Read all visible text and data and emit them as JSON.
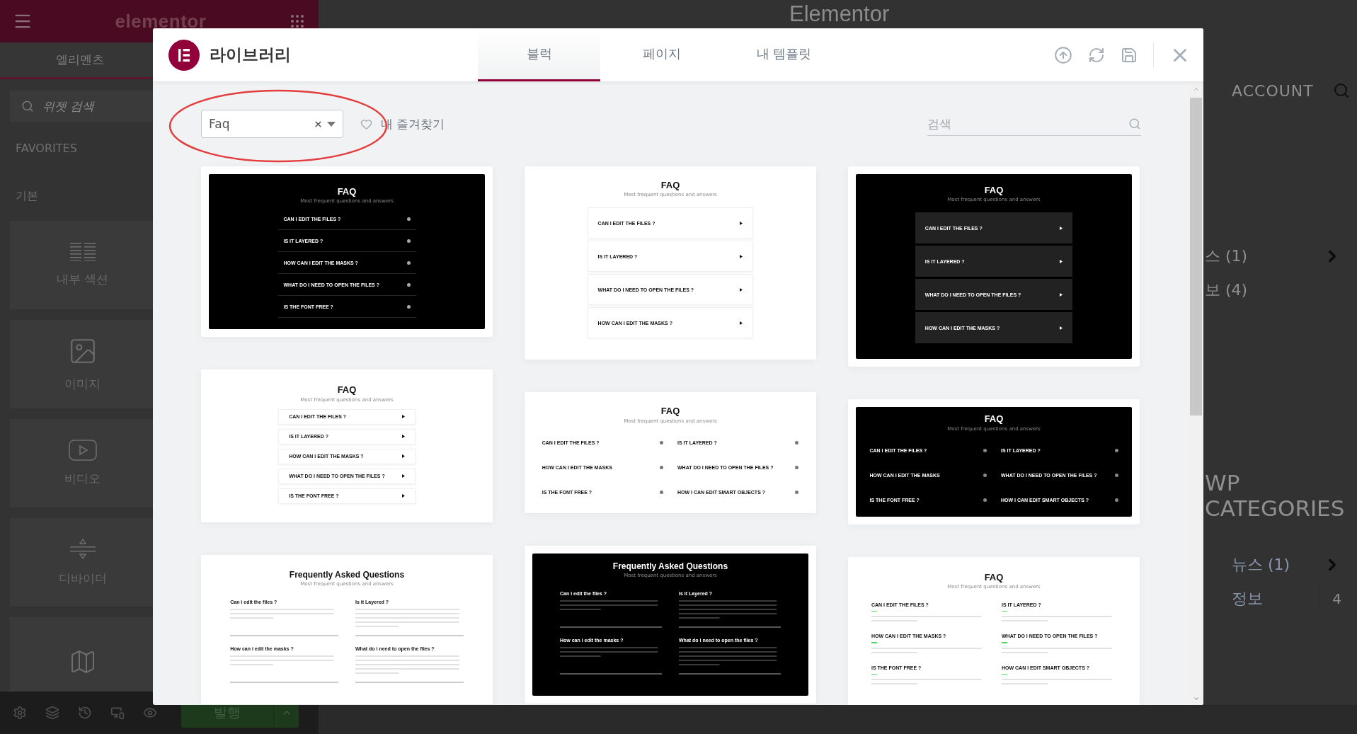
{
  "editor_panel": {
    "logo": "elementor",
    "tabs": [
      {
        "label": "엘리멘츠",
        "selected": true
      }
    ],
    "search": {
      "placeholder": "위젯 검색"
    },
    "headings": [
      "FAVORITES",
      "기본"
    ],
    "widgets": [
      {
        "kind": "inner-section",
        "label": "내부 섹션"
      },
      {
        "kind": "image",
        "label": "이미지"
      },
      {
        "kind": "video",
        "label": "비디오"
      },
      {
        "kind": "divider",
        "label": "디바이더"
      },
      {
        "kind": "map"
      }
    ],
    "publish_button": "발행"
  },
  "page_background": {
    "title": "Elementor",
    "account": "ACCOUNT",
    "list_1": [
      {
        "label": "스 (1)",
        "has_submenu": true
      },
      {
        "label": "보 (4)",
        "has_submenu": false
      }
    ],
    "heading_lines": [
      "WP",
      "CATEGORIES"
    ],
    "list_2": [
      {
        "label": "뉴스 (1)",
        "has_submenu": true
      },
      {
        "label": "정보",
        "count": "4",
        "has_submenu": false
      }
    ]
  },
  "library_modal": {
    "title": "라이브러리",
    "tabs": [
      {
        "label": "블럭",
        "selected": true
      },
      {
        "label": "페이지",
        "selected": false
      },
      {
        "label": "내 템플릿",
        "selected": false
      }
    ],
    "filter": {
      "category": "Faq",
      "favorites_label": "내 즐겨찾기"
    },
    "search": {
      "placeholder": "검색"
    },
    "template_columns": [
      {
        "templates": [
          {
            "kind": "list",
            "dark": true,
            "title": "FAQ",
            "subtitle": "Most frequent questions and answers",
            "questions": [
              "CAN I EDIT THE FILES ?",
              "IS IT LAYERED ?",
              "HOW CAN I EDIT THE MASKS ?",
              "WHAT DO I NEED TO OPEN THE FILES ?",
              "IS THE FONT FREE ?"
            ]
          },
          {
            "kind": "boxed",
            "dark": false,
            "title": "FAQ",
            "subtitle": "Most frequent questions and answers",
            "questions": [
              "CAN I EDIT THE FILES ?",
              "IS IT LAYERED ?",
              "HOW CAN I EDIT THE MASKS ?",
              "WHAT DO I NEED TO OPEN THE FILES ?",
              "IS THE FONT FREE ?"
            ]
          },
          {
            "kind": "qa",
            "dark": false,
            "title": "Frequently Asked Questions",
            "subtitle": "Most frequent questions and answers",
            "questions": [
              "Can i edit the files ?",
              "Is it Layered ?",
              "How can i edit the masks ?",
              "What do i need to open the files ?"
            ]
          }
        ]
      },
      {
        "templates": [
          {
            "kind": "boxed",
            "dark": false,
            "title": "FAQ",
            "subtitle": "Most frequent questions and answers",
            "questions": [
              "CAN I EDIT THE FILES ?",
              "IS IT LAYERED ?",
              "WHAT DO I NEED TO OPEN THE FILES ?",
              "HOW CAN I EDIT THE MASKS ?"
            ]
          },
          {
            "kind": "grid",
            "dark": false,
            "title": "FAQ",
            "subtitle": "Most frequent questions and answers",
            "questions": [
              "CAN I EDIT THE FILES ?",
              "IS IT LAYERED ?",
              "HOW CAN I EDIT THE MASKS",
              "WHAT DO I NEED TO OPEN THE FILES ?",
              "IS THE FONT FREE ?",
              "HOW I CAN EDIT SMART OBJECTS ?"
            ]
          },
          {
            "kind": "qa",
            "dark": true,
            "title": "Frequently Asked Questions",
            "subtitle": "Most frequent questions and answers",
            "questions": [
              "Can i edit the files ?",
              "Is it Layered ?",
              "How can i edit the masks ?",
              "What do i need to open the files ?"
            ]
          }
        ]
      },
      {
        "templates": [
          {
            "kind": "boxed",
            "dark": true,
            "title": "FAQ",
            "subtitle": "Most frequent questions and answers",
            "questions": [
              "CAN I EDIT THE FILES ?",
              "IS IT LAYERED ?",
              "WHAT DO I NEED TO OPEN THE FILES ?",
              "HOW CAN I EDIT THE MASKS ?"
            ]
          },
          {
            "kind": "grid",
            "dark": true,
            "title": "FAQ",
            "subtitle": "Most frequent questions and answers",
            "questions": [
              "CAN I EDIT THE FILES ?",
              "IS IT LAYERED ?",
              "HOW CAN I EDIT THE MASKS",
              "WHAT DO I NEED TO OPEN THE FILES ?",
              "IS THE FONT FREE ?",
              "HOW I CAN EDIT SMART OBJECTS ?"
            ]
          },
          {
            "kind": "dashed",
            "dark": false,
            "title": "FAQ",
            "subtitle": "Most frequent questions and answers",
            "questions": [
              "CAN I EDIT THE FILES ?",
              "IS IT LAYERED ?",
              "HOW CAN I EDIT THE MASKS ?",
              "WHAT DO I NEED TO OPEN THE FILES ?",
              "IS THE FONT FREE ?",
              "HOW CAN I EDIT SMART OBJECTS ?"
            ]
          }
        ]
      }
    ]
  }
}
